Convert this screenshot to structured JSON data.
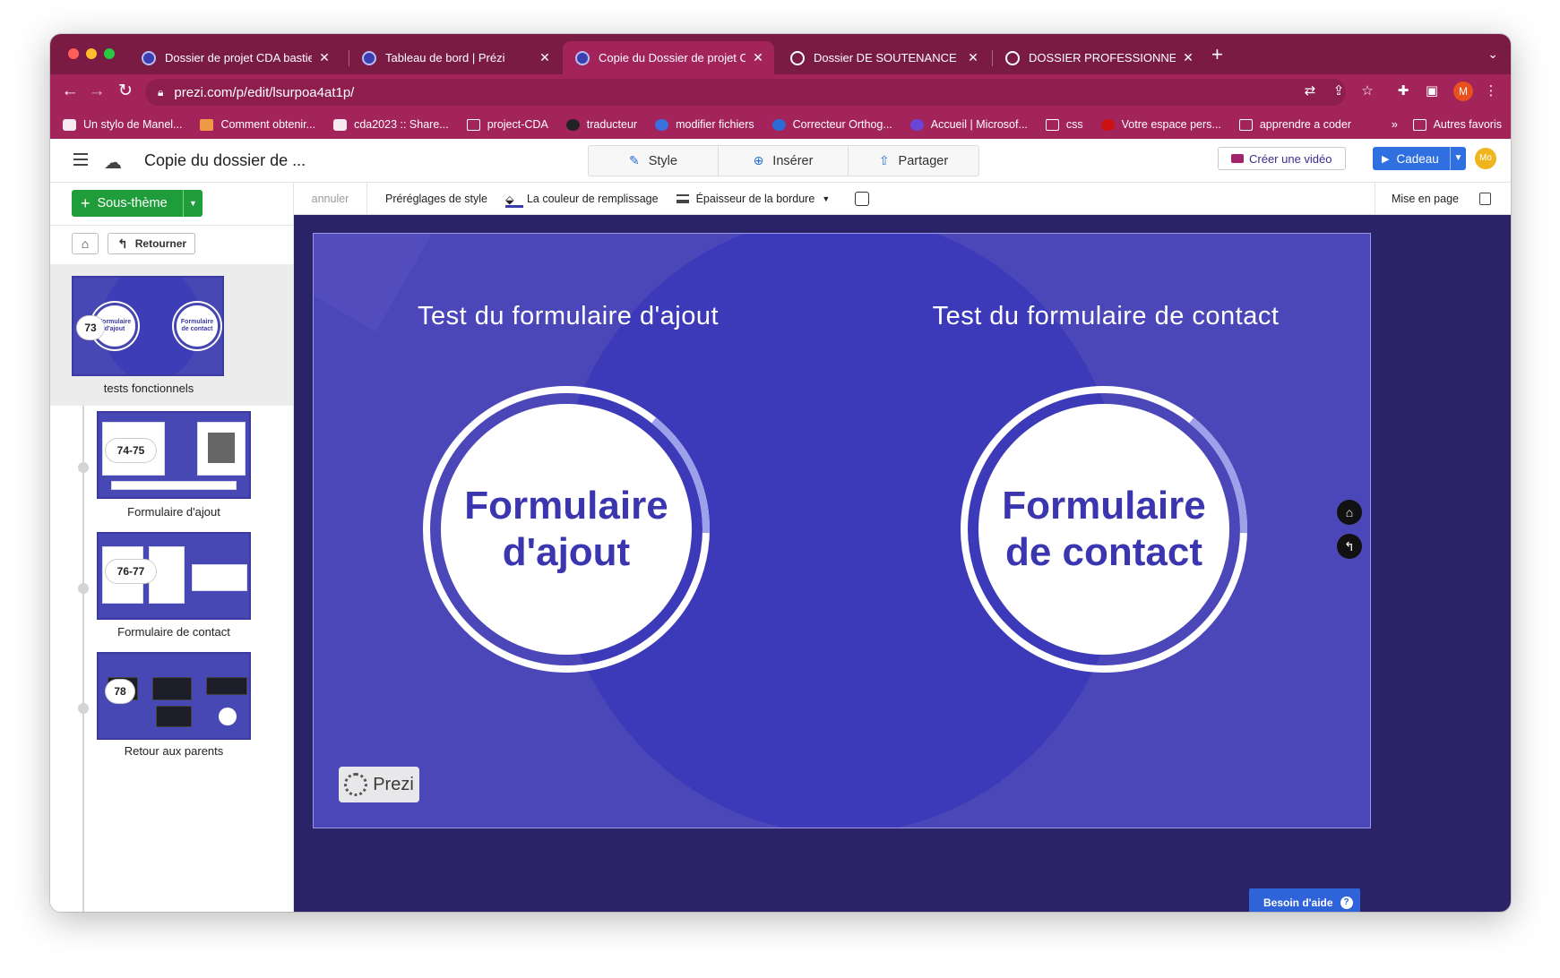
{
  "browser": {
    "tabs": [
      {
        "title": "Dossier de projet CDA bastien",
        "favicon": "prezi-icon"
      },
      {
        "title": "Tableau de bord | Prézi",
        "favicon": "prezi-icon"
      },
      {
        "title": "Copie du Dossier de projet CDA",
        "favicon": "prezi-icon",
        "active": true
      },
      {
        "title": "Dossier DE SOUTENANCE POU",
        "favicon": "globe-icon"
      },
      {
        "title": "DOSSIER PROFESSIONNEL (DF",
        "favicon": "globe-icon"
      }
    ],
    "new_tab": "+",
    "url": "prezi.com/p/edit/lsurpoa4at1p/",
    "profile_initial": "M",
    "bookmarks": [
      "Un stylo de Manel...",
      "Comment obtenir...",
      "cda2023 :: Share...",
      "project-CDA",
      "traducteur",
      "modifier fichiers",
      "Correcteur Orthog...",
      "Accueil | Microsof...",
      "css",
      "Votre espace pers...",
      "apprendre a coder"
    ],
    "bookmarks_more": "»",
    "other_bookmarks": "Autres favoris"
  },
  "app": {
    "doc_title": "Copie du dossier de ...",
    "modes": [
      "Style",
      "Insérer",
      "Partager"
    ],
    "create_video": "Créer une vidéo",
    "gift": "Cadeau",
    "user_initials": "Mo"
  },
  "sidebar": {
    "subtheme_button": "Sous-thème",
    "back_button": "Retourner",
    "items": [
      {
        "label": "tests fonctionnels",
        "badge": "73",
        "thumb_left": "Formulaire d'ajout",
        "thumb_right": "Formulaire de contact"
      },
      {
        "label": "Formulaire d'ajout",
        "badge": "74-75"
      },
      {
        "label": "Formulaire de contact",
        "badge": "76-77"
      },
      {
        "label": "Retour aux parents",
        "badge": "78"
      }
    ]
  },
  "toolbar": {
    "undo": "annuler",
    "style_presets": "Préréglages de style",
    "fill_color": "La couleur de remplissage",
    "border_thickness": "Épaisseur de la bordure",
    "layout": "Mise en page"
  },
  "slide": {
    "left_heading": "Test du formulaire d'ajout",
    "right_heading": "Test du formulaire de contact",
    "left_circle_line1": "Formulaire",
    "left_circle_line2": "d'ajout",
    "right_circle_line1": "Formulaire",
    "right_circle_line2": "de contact",
    "logo_text": "Prezi"
  },
  "help_button": "Besoin d'aide",
  "colors": {
    "browser_chrome": "#a3245a",
    "tab_strip": "#7a1b43",
    "slide_bg": "#4b47b9",
    "accent_circle": "#3c3ab8",
    "primary_blue": "#2f6fe0",
    "green": "#1f9d3a"
  }
}
